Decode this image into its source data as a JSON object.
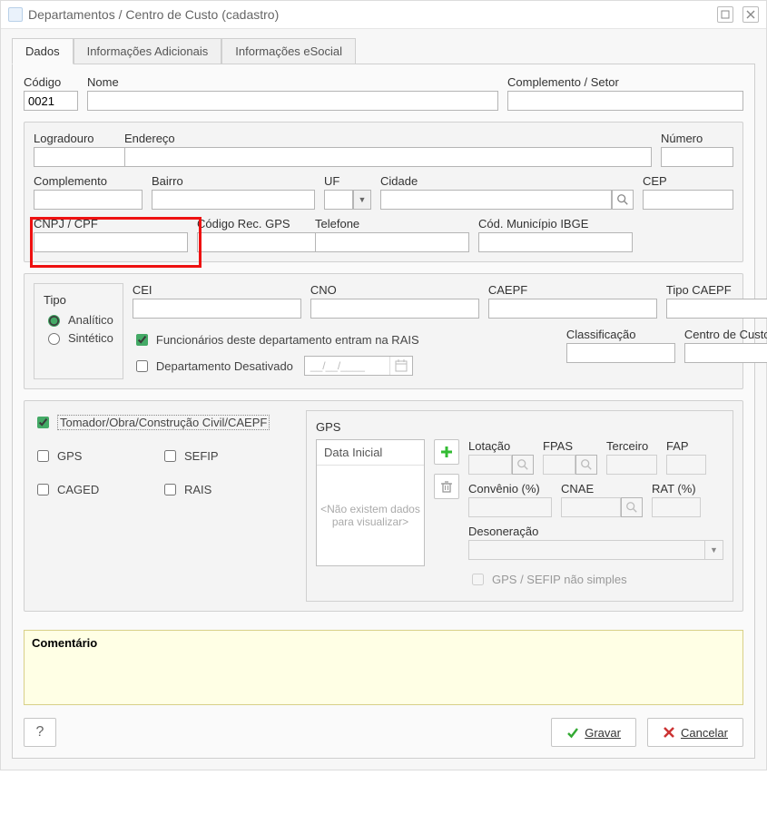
{
  "window": {
    "title": "Departamentos / Centro de Custo (cadastro)"
  },
  "tabs": {
    "dados": "Dados",
    "info_adicionais": "Informações Adicionais",
    "info_esocial": "Informações eSocial"
  },
  "fields": {
    "codigo": {
      "label": "Código",
      "value": "0021"
    },
    "nome": {
      "label": "Nome",
      "value": ""
    },
    "complemento_setor": {
      "label": "Complemento / Setor",
      "value": ""
    },
    "address": {
      "logradouro": {
        "label": "Logradouro",
        "value": ""
      },
      "endereco": {
        "label": "Endereço",
        "value": ""
      },
      "numero": {
        "label": "Número",
        "value": ""
      },
      "complemento": {
        "label": "Complemento",
        "value": ""
      },
      "bairro": {
        "label": "Bairro",
        "value": ""
      },
      "uf": {
        "label": "UF",
        "value": ""
      },
      "cidade": {
        "label": "Cidade",
        "value": ""
      },
      "cep": {
        "label": "CEP",
        "value": ""
      },
      "cnpj_cpf": {
        "label": "CNPJ / CPF",
        "value": ""
      },
      "codigo_rec_gps": {
        "label": "Código Rec. GPS",
        "value": ""
      },
      "telefone": {
        "label": "Telefone",
        "value": ""
      },
      "cod_municipio_ibge": {
        "label": "Cód. Município IBGE",
        "value": ""
      }
    },
    "tipo": {
      "group_label": "Tipo",
      "analitico": "Analítico",
      "sintetico": "Sintético",
      "selected": "analitico"
    },
    "cei": {
      "label": "CEI",
      "value": ""
    },
    "cno": {
      "label": "CNO",
      "value": ""
    },
    "caepf": {
      "label": "CAEPF",
      "value": ""
    },
    "tipo_caepf": {
      "label": "Tipo CAEPF",
      "value": ""
    },
    "func_rais": {
      "label": "Funcionários deste departamento entram na RAIS",
      "checked": true
    },
    "depto_desativado": {
      "label": "Departamento Desativado",
      "checked": false,
      "date_placeholder": "__/__/____"
    },
    "classificacao": {
      "label": "Classificação",
      "value": ""
    },
    "centro_custo": {
      "label": "Centro de Custo",
      "value": ""
    }
  },
  "opts": {
    "tomador": {
      "label": "Tomador/Obra/Construção Civil/CAEPF",
      "checked": true
    },
    "gps": {
      "label": "GPS",
      "checked": false
    },
    "sefip": {
      "label": "SEFIP",
      "checked": false
    },
    "caged": {
      "label": "CAGED",
      "checked": false
    },
    "rais": {
      "label": "RAIS",
      "checked": false
    }
  },
  "gps_box": {
    "legend": "GPS",
    "list_header": "Data Inicial",
    "list_empty": "<Não existem dados para visualizar>",
    "lotacao": "Lotação",
    "fpas": "FPAS",
    "terceiro": "Terceiro",
    "fap": "FAP",
    "convenio": "Convênio (%)",
    "cnae": "CNAE",
    "rat": "RAT (%)",
    "desoneracao": "Desoneração",
    "gps_sefip_nao_simples": "GPS / SEFIP não simples"
  },
  "comment": {
    "title": "Comentário"
  },
  "buttons": {
    "help": "?",
    "gravar": "Gravar",
    "cancelar": "Cancelar"
  }
}
